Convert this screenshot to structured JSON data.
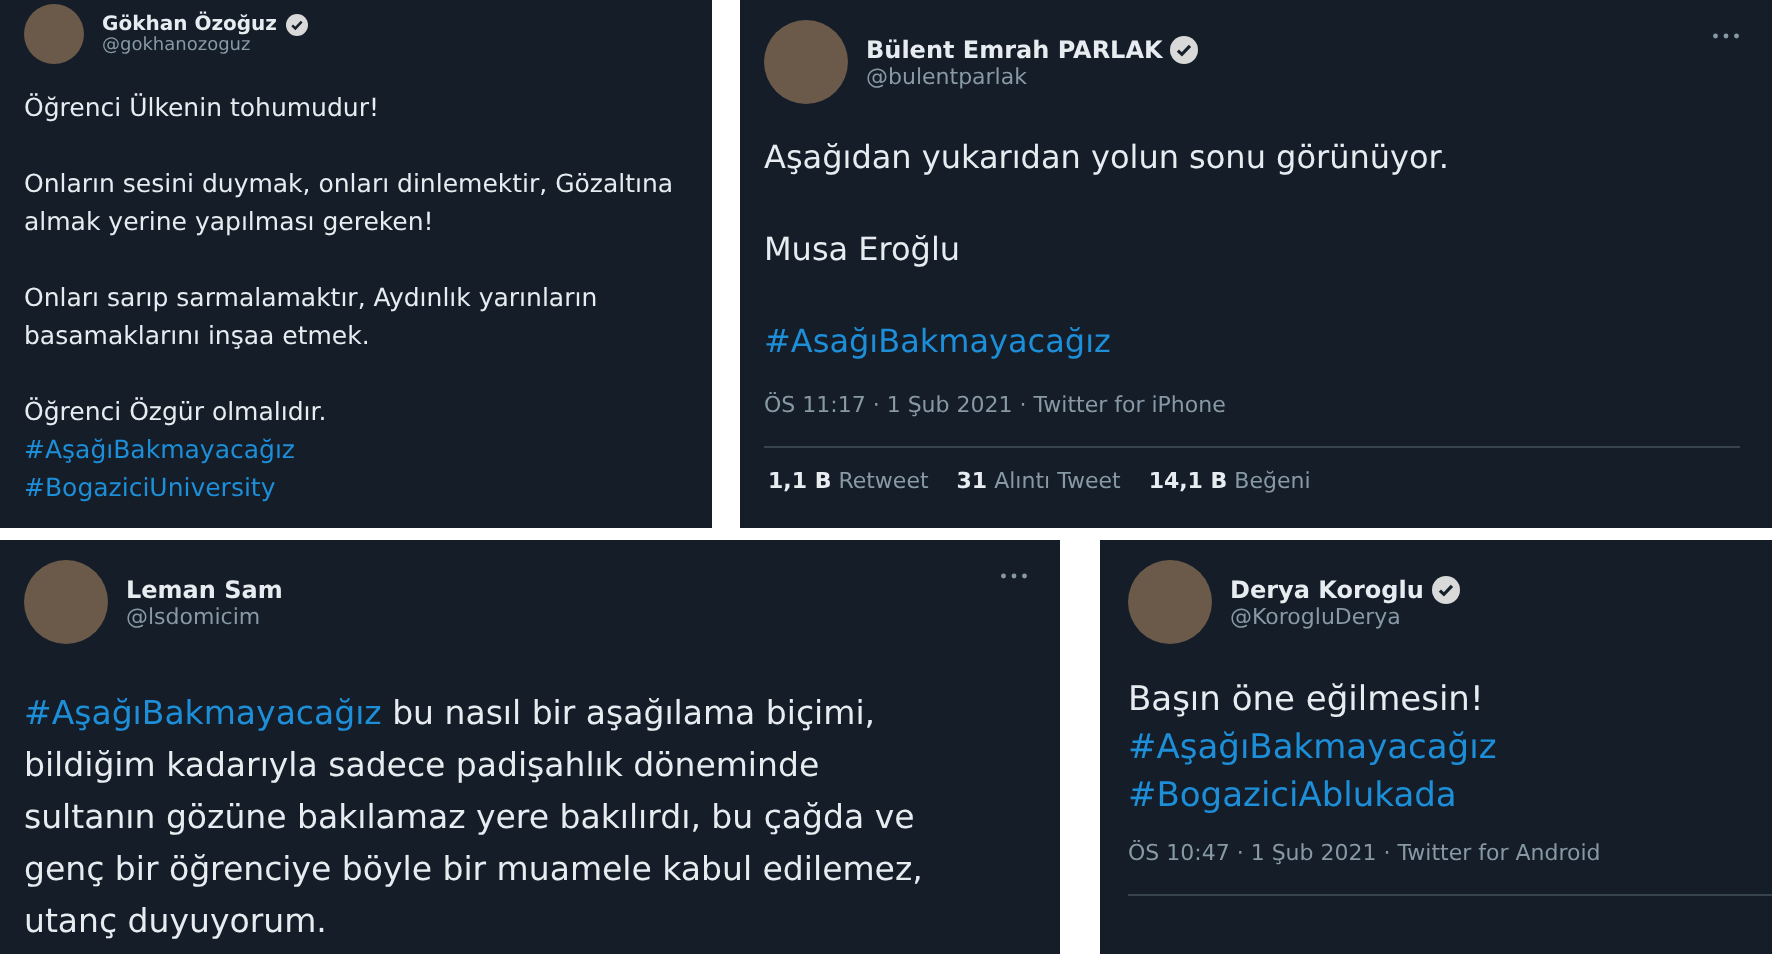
{
  "tweets": [
    {
      "name": "Gökhan Özoğuz",
      "verified": true,
      "handle": "@gokhanozoguz",
      "more": false,
      "paragraphs": [
        [
          {
            "kind": "text",
            "text": "Öğrenci Ülkenin tohumudur!"
          }
        ],
        [
          {
            "kind": "text",
            "text": "Onların sesini duymak, onları dinlemektir, Gözaltına almak yerine yapılması gereken!"
          }
        ],
        [
          {
            "kind": "text",
            "text": "Onları sarıp sarmalamaktır, Aydınlık yarınların basamaklarını inşaa etmek."
          }
        ],
        [
          {
            "kind": "text",
            "text": "Öğrenci Özgür olmalıdır."
          },
          {
            "kind": "break"
          },
          {
            "kind": "hashtag",
            "text": "#AşağıBakmayacağız"
          },
          {
            "kind": "break"
          },
          {
            "kind": "hashtag",
            "text": "#BogaziciUniversity"
          }
        ]
      ]
    },
    {
      "name": "Bülent Emrah PARLAK",
      "verified": true,
      "handle": "@bulentparlak",
      "more": true,
      "paragraphs": [
        [
          {
            "kind": "text",
            "text": "Aşağıdan yukarıdan yolun sonu görünüyor."
          }
        ],
        [
          {
            "kind": "text",
            "text": "Musa Eroğlu"
          }
        ],
        [
          {
            "kind": "hashtag",
            "text": "#AsağıBakmayacağız"
          }
        ]
      ],
      "meta": "ÖS 11:17 · 1 Şub 2021 · Twitter for iPhone",
      "stats": [
        {
          "count": "1,1 B",
          "label": "Retweet"
        },
        {
          "count": "31",
          "label": "Alıntı Tweet"
        },
        {
          "count": "14,1 B",
          "label": "Beğeni"
        }
      ]
    },
    {
      "name": "Leman Sam",
      "verified": false,
      "handle": "@lsdomicim",
      "more": true,
      "paragraphs": [
        [
          {
            "kind": "hashtag",
            "text": "#AşağıBakmayacağız"
          },
          {
            "kind": "text",
            "text": " bu nasıl bir aşağılama biçimi, bildiğim kadarıyla sadece padişahlık döneminde sultanın gözüne bakılamaz yere bakılırdı, bu çağda ve genç bir öğrenciye böyle bir muamele kabul edilemez, utanç duyuyorum."
          }
        ]
      ]
    },
    {
      "name": "Derya Koroglu",
      "verified": true,
      "handle": "@KorogluDerya",
      "more": false,
      "paragraphs": [
        [
          {
            "kind": "text",
            "text": "Başın öne eğilmesin!"
          },
          {
            "kind": "break"
          },
          {
            "kind": "hashtag",
            "text": "#AşağıBakmayacağız"
          },
          {
            "kind": "break"
          },
          {
            "kind": "hashtag",
            "text": "#BogaziciAblukada"
          }
        ]
      ],
      "meta": "ÖS 10:47 · 1 Şub 2021 · Twitter for Android"
    }
  ]
}
